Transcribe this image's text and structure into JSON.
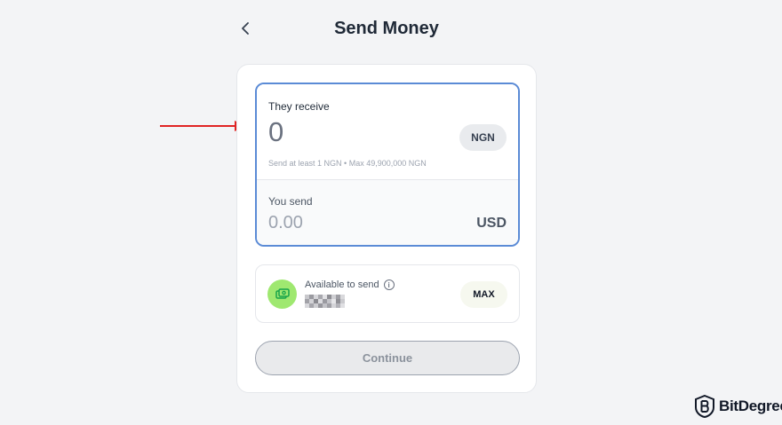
{
  "header": {
    "title": "Send Money",
    "back_icon": "chevron-left-icon"
  },
  "amount": {
    "receive_label": "They receive",
    "receive_value": "0",
    "receive_currency": "NGN",
    "limits_text": "Send at least 1 NGN • Max 49,900,000 NGN",
    "send_label": "You send",
    "send_placeholder": "0.00",
    "send_currency": "USD"
  },
  "balance": {
    "label": "Available to send",
    "info_icon": "info-icon",
    "wallet_icon": "wallet-icon",
    "value_masked": true,
    "max_label": "MAX"
  },
  "actions": {
    "continue_label": "Continue"
  },
  "watermark": {
    "brand": "BitDegree",
    "logo_icon": "bitdegree-logo-icon"
  },
  "colors": {
    "background": "#f3f4f6",
    "focus_border": "#5b8bd6",
    "wallet_accent": "#9fe870",
    "annotation_arrow": "#e02424"
  }
}
